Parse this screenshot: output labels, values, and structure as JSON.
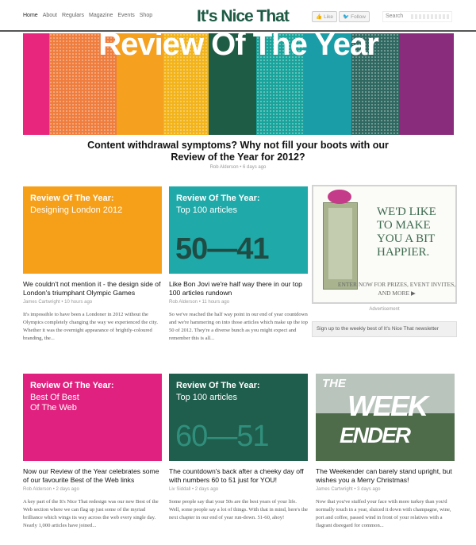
{
  "header": {
    "nav": [
      "Home",
      "About",
      "Regulars",
      "Magazine",
      "Events",
      "Shop"
    ],
    "logo": "It's Nice That",
    "like_label": "Like",
    "follow_label": "Follow",
    "search_placeholder": "Search"
  },
  "hero": {
    "title": "Review Of The Year",
    "stripe_colors": [
      "#e8267d",
      "#ef7d3e",
      "#f6a020",
      "#f3b31a",
      "#1f5c45",
      "#18a39b",
      "#1b9da7",
      "#2f6860",
      "#8a2c7c"
    ]
  },
  "feature": {
    "title": "Content withdrawal symptoms? Why not fill your boots with our Review of the Year for 2012?",
    "meta": "Rob Alderson • 6 days ago"
  },
  "cards": [
    {
      "thumb_line1": "Review Of The Year:",
      "thumb_line2": "Designing London 2012",
      "thumb_color": "#f6a01a",
      "title": "We couldn't not mention it - the design side of London's triumphant Olympic Games",
      "meta": "James Cartwright • 10 hours ago",
      "excerpt": "It's impossible to have been a Londoner in 2012 without the Olympics completely changing the way we experienced the city. Whether it was the overnight appearance of brightly-coloured branding, the..."
    },
    {
      "thumb_line1": "Review Of The Year:",
      "thumb_line2": "Top 100 articles",
      "thumb_number": "50—41",
      "thumb_color": "#1fa9a8",
      "number_color": "#1f4c44",
      "title": "Like Bon Jovi we're half way there in our top 100 articles rundown",
      "meta": "Rob Alderson • 11 hours ago",
      "excerpt": "So we've reached the half way point in our end of year countdown and we're hammering on into those articles which make up the top 50 of 2012. They're a diverse bunch as you might expect and remember this is all..."
    },
    {
      "thumb_line1": "Review Of The Year:",
      "thumb_line2": "Best Of Best",
      "thumb_line3": "Of The Web",
      "thumb_color": "#e0217f",
      "title": "Now our Review of the Year celebrates some of our favourite Best of the Web links",
      "meta": "Rob Alderson • 2 days ago",
      "excerpt": "A key part of the It's Nice That redesign was our new Best of the Web section where we can flag up just some of the myriad brilliance which wings its way across the web every single day. Nearly 1,000 articles have joined..."
    },
    {
      "thumb_line1": "Review Of The Year:",
      "thumb_line2": "Top 100 articles",
      "thumb_number": "60—51",
      "thumb_color": "#1f5d4c",
      "number_color": "#2f8f7c",
      "title": "The countdown's back after a cheeky day off with numbers 60 to 51 just for YOU!",
      "meta": "Liv Siddall • 2 days ago",
      "excerpt": "Some people say that your 50s are the best years of your life. Well, some people say a lot of things. With that in mind, here's the next chapter in our end of year run-down. 51-60, ahoy!"
    },
    {
      "thumb_word1": "THE",
      "thumb_word2": "WEEK",
      "thumb_word3": "ENDER",
      "title": "The Weekender can barely stand upright, but wishes you a Merry Christmas!",
      "meta": "James Cartwright • 3 days ago",
      "excerpt": "Now that you've stuffed your face with more turkey than you'd normally touch in a year, sluiced it down with champagne, wine, port and coffee, passed wind in front of your relatives with a flagrant disregard for common..."
    }
  ],
  "ad": {
    "headline": "WE'D LIKE TO MAKE YOU A BIT HAPPIER.",
    "sub": "ENTER NOW FOR PRIZES, EVENT INVITES, AND MORE ▶",
    "caption": "Advertisement",
    "newsletter": "Sign up to the weekly best of It's Nice That newsletter"
  }
}
